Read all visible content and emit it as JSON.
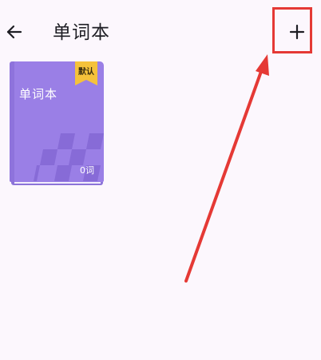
{
  "header": {
    "title": "单词本",
    "back_icon": "arrow-left-icon",
    "add_icon": "plus-icon"
  },
  "books": [
    {
      "name": "单词本",
      "badge": "默认",
      "word_count": "0词"
    }
  ],
  "colors": {
    "background": "#fcf7fd",
    "book_cover": "#9a7fe6",
    "badge": "#f5c23a",
    "annotation": "#e53935"
  }
}
